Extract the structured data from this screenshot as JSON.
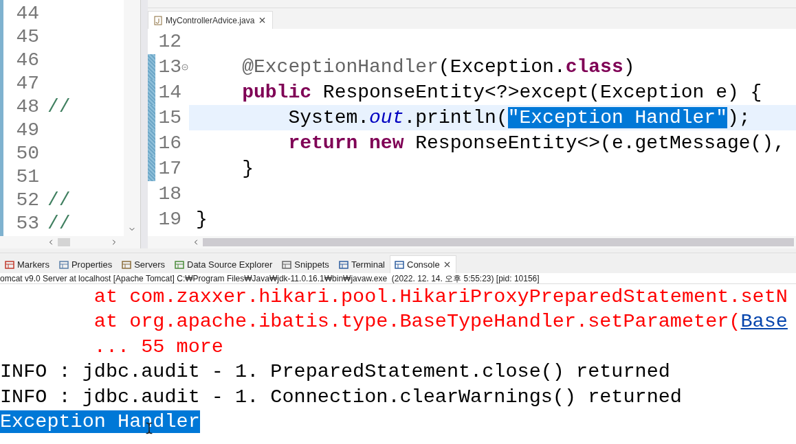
{
  "left_editor": {
    "lines": [
      {
        "number": "44"
      },
      {
        "number": "45"
      },
      {
        "number": "46"
      },
      {
        "number": "47"
      },
      {
        "number": "48",
        "text": "//"
      },
      {
        "number": "49"
      },
      {
        "number": "50"
      },
      {
        "number": "51"
      },
      {
        "number": "52",
        "text": "//"
      },
      {
        "number": "53",
        "text": "//"
      }
    ]
  },
  "editor": {
    "tab": {
      "title": "MyControllerAdvice.java"
    },
    "lines": [
      {
        "number": "12",
        "current": false,
        "changed": false,
        "fold": false
      },
      {
        "number": "13",
        "current": false,
        "changed": true,
        "fold": true,
        "segments": [
          {
            "text": "    @ExceptionHandler",
            "kind": "annotation"
          },
          {
            "text": "(Exception.",
            "kind": "plain"
          },
          {
            "text": "class",
            "kind": "keyword"
          },
          {
            "text": ")",
            "kind": "plain"
          }
        ]
      },
      {
        "number": "14",
        "current": false,
        "changed": true,
        "fold": false,
        "segments": [
          {
            "text": "    public",
            "kind": "keyword"
          },
          {
            "text": " ResponseEntity<?>except(Exception e) {",
            "kind": "plain"
          }
        ]
      },
      {
        "number": "15",
        "current": true,
        "changed": true,
        "fold": false,
        "segments": [
          {
            "text": "        System.",
            "kind": "plain"
          },
          {
            "text": "out",
            "kind": "field"
          },
          {
            "text": ".println(",
            "kind": "plain"
          },
          {
            "text": "\"Exception Handler\"",
            "kind": "selected"
          },
          {
            "text": ");",
            "kind": "plain"
          }
        ]
      },
      {
        "number": "16",
        "current": false,
        "changed": true,
        "fold": false,
        "segments": [
          {
            "text": "        return new",
            "kind": "keyword"
          },
          {
            "text": " ResponseEntity<>(e.getMessage(),",
            "kind": "plain"
          }
        ]
      },
      {
        "number": "17",
        "current": false,
        "changed": true,
        "fold": false,
        "segments": [
          {
            "text": "    }",
            "kind": "plain"
          }
        ]
      },
      {
        "number": "18",
        "current": false,
        "changed": false,
        "fold": false
      },
      {
        "number": "19",
        "current": false,
        "changed": false,
        "fold": false,
        "segments": [
          {
            "text": "}",
            "kind": "plain"
          }
        ]
      }
    ]
  },
  "views": [
    {
      "label": "Markers",
      "selected": false,
      "kind": "markers"
    },
    {
      "label": "Properties",
      "selected": false,
      "kind": "table"
    },
    {
      "label": "Servers",
      "selected": false,
      "kind": "servers"
    },
    {
      "label": "Data Source Explorer",
      "selected": false,
      "kind": "database"
    },
    {
      "label": "Snippets",
      "selected": false,
      "kind": "snippets"
    },
    {
      "label": "Terminal",
      "selected": false,
      "kind": "terminal"
    },
    {
      "label": "Console",
      "selected": true,
      "kind": "console"
    }
  ],
  "console": {
    "status": "omcat v9.0 Server at localhost [Apache Tomcat] C:₩Program Files₩Java₩jdk-11.0.16.1₩bin₩javaw.exe  (2022. 12. 14. 오후 5:55:23) [pid: 10156]",
    "lines": [
      {
        "segments": [
          {
            "text": "        at com.zaxxer.hikari.pool.HikariProxyPreparedStatement.setN",
            "kind": "error"
          }
        ]
      },
      {
        "segments": [
          {
            "text": "        at org.apache.ibatis.type.BaseTypeHandler.setParameter(",
            "kind": "error"
          },
          {
            "text": "Base",
            "kind": "link"
          }
        ]
      },
      {
        "segments": [
          {
            "text": "        ... 55 more",
            "kind": "error"
          }
        ]
      },
      {
        "segments": [
          {
            "text": "INFO : jdbc.audit - 1. PreparedStatement.close() returned",
            "kind": "plain"
          }
        ]
      },
      {
        "segments": [
          {
            "text": "INFO : jdbc.audit - 1. Connection.clearWarnings() returned",
            "kind": "plain"
          }
        ]
      },
      {
        "segments": [
          {
            "text": "Exception Handler",
            "kind": "selected"
          }
        ]
      }
    ]
  }
}
